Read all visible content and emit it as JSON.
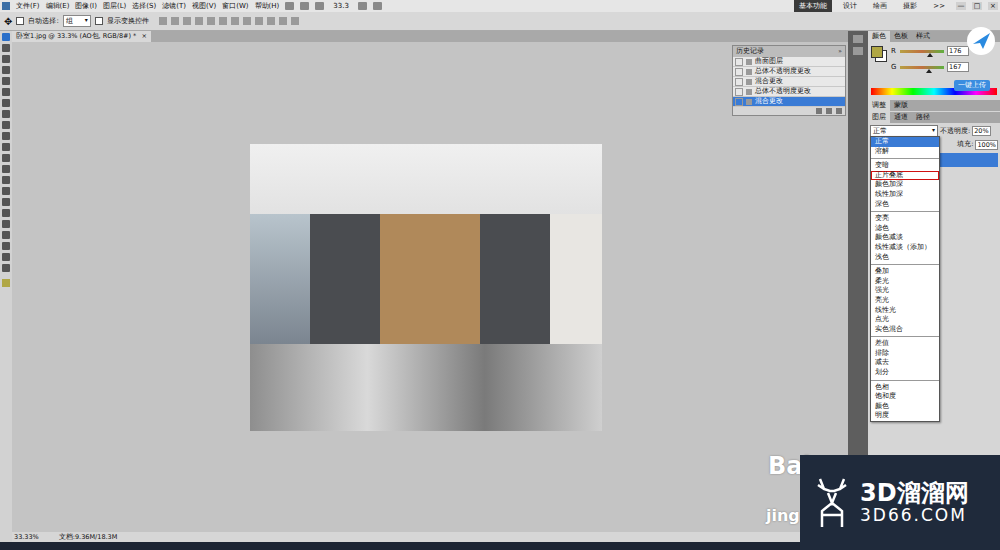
{
  "menu": [
    "文件(F)",
    "编辑(E)",
    "图像(I)",
    "图层(L)",
    "选择(S)",
    "滤镜(T)",
    "视图(V)",
    "窗口(W)",
    "帮助(H)"
  ],
  "zoom": "33.3",
  "workspaces": [
    {
      "label": "基本功能",
      "selected": true
    },
    {
      "label": "设计",
      "selected": false
    },
    {
      "label": "绘画",
      "selected": false
    },
    {
      "label": "摄影",
      "selected": false
    }
  ],
  "workspace_more": ">>",
  "window_controls": [
    "—",
    "□",
    "×"
  ],
  "options_bar": {
    "auto_select_label": "自动选择:",
    "auto_select_checked": false,
    "auto_select_value": "组",
    "show_transform_label": "显示变换控件",
    "show_transform_checked": false
  },
  "document_tab": {
    "title": "卧室1.jpg @ 33.3% (AO包, RGB/8#) *",
    "close": "×"
  },
  "history_panel": {
    "title": "历史记录",
    "items": [
      {
        "label": "曲面图层",
        "selected": false
      },
      {
        "label": "总体不透明度更改",
        "selected": false
      },
      {
        "label": "混合更改",
        "selected": false
      },
      {
        "label": "总体不透明度更改",
        "selected": false
      },
      {
        "label": "混合更改",
        "selected": true
      }
    ]
  },
  "color_panel": {
    "tabs": [
      {
        "label": "颜色",
        "selected": true
      },
      {
        "label": "色板",
        "selected": false
      },
      {
        "label": "样式",
        "selected": false
      }
    ],
    "channels": [
      {
        "name": "R",
        "value": "176",
        "level": 0.69
      },
      {
        "name": "G",
        "value": "167",
        "level": 0.65
      }
    ]
  },
  "upload_button": "一键上传",
  "adjust_tabs": [
    {
      "label": "调整",
      "selected": true
    },
    {
      "label": "蒙版",
      "selected": false
    }
  ],
  "layers_panel": {
    "tabs": [
      {
        "label": "图层",
        "selected": true
      },
      {
        "label": "通道",
        "selected": false
      },
      {
        "label": "路径",
        "selected": false
      }
    ],
    "blend_mode": "正常",
    "opacity_label": "不透明度:",
    "opacity": "20%",
    "fill_label": "填充:",
    "fill": "100%",
    "layers": [
      {
        "selected": true
      }
    ]
  },
  "blend_menu": {
    "groups": [
      [
        {
          "label": "正常",
          "selected": true,
          "marked": false
        },
        {
          "label": "溶解",
          "selected": false,
          "marked": false
        }
      ],
      [
        {
          "label": "变暗",
          "selected": false,
          "marked": false
        },
        {
          "label": "正片叠底",
          "selected": false,
          "marked": true
        },
        {
          "label": "颜色加深",
          "selected": false,
          "marked": false
        },
        {
          "label": "线性加深",
          "selected": false,
          "marked": false
        },
        {
          "label": "深色",
          "selected": false,
          "marked": false
        }
      ],
      [
        {
          "label": "变亮",
          "selected": false,
          "marked": false
        },
        {
          "label": "滤色",
          "selected": false,
          "marked": false
        },
        {
          "label": "颜色减淡",
          "selected": false,
          "marked": false
        },
        {
          "label": "线性减淡（添加）",
          "selected": false,
          "marked": false
        },
        {
          "label": "浅色",
          "selected": false,
          "marked": false
        }
      ],
      [
        {
          "label": "叠加",
          "selected": false,
          "marked": false
        },
        {
          "label": "柔光",
          "selected": false,
          "marked": false
        },
        {
          "label": "强光",
          "selected": false,
          "marked": false
        },
        {
          "label": "亮光",
          "selected": false,
          "marked": false
        },
        {
          "label": "线性光",
          "selected": false,
          "marked": false
        },
        {
          "label": "点光",
          "selected": false,
          "marked": false
        },
        {
          "label": "实色混合",
          "selected": false,
          "marked": false
        }
      ],
      [
        {
          "label": "差值",
          "selected": false,
          "marked": false
        },
        {
          "label": "排除",
          "selected": false,
          "marked": false
        },
        {
          "label": "减去",
          "selected": false,
          "marked": false
        },
        {
          "label": "划分",
          "selected": false,
          "marked": false
        }
      ],
      [
        {
          "label": "色相",
          "selected": false,
          "marked": false
        },
        {
          "label": "饱和度",
          "selected": false,
          "marked": false
        },
        {
          "label": "颜色",
          "selected": false,
          "marked": false
        },
        {
          "label": "明度",
          "selected": false,
          "marked": false
        }
      ]
    ]
  },
  "status_bar": {
    "zoom": "33.33%",
    "doc": "文档:9.36M/18.3M"
  },
  "watermarks": {
    "brand": "3D溜溜网",
    "domain": "3D66.COM",
    "baidu_top": "Bai",
    "baidu_bottom": "jing"
  }
}
